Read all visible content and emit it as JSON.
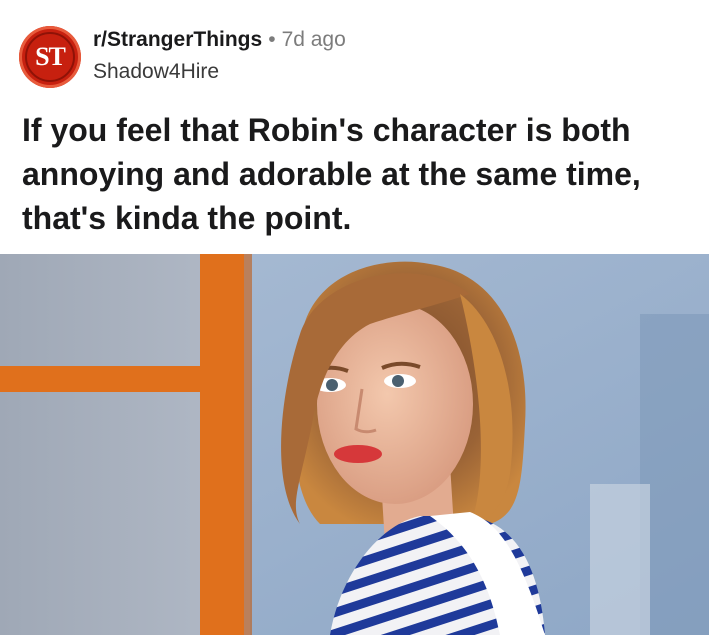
{
  "post": {
    "subreddit": "r/StrangerThings",
    "separator": "•",
    "age": "7d ago",
    "author": "Shadow4Hire",
    "avatar_text": "ST",
    "title": "If you feel that Robin's character is both annoying and adorable at the same time, that's kinda the point."
  },
  "colors": {
    "avatar_red": "#c7200f",
    "title_text": "#1a1a1b",
    "meta_gray": "#7c7c7c",
    "window_frame_orange": "#e0701c"
  },
  "image": {
    "description_icon": "photo-icon"
  }
}
